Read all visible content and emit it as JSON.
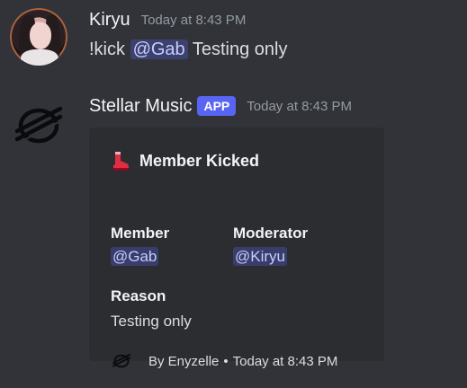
{
  "messages": [
    {
      "author": "Kiryu",
      "timestamp": "Today at 8:43 PM",
      "content": {
        "prefix": "!kick",
        "mention": "@Gab",
        "suffix": "Testing only"
      }
    },
    {
      "author": "Stellar Music",
      "badge": "APP",
      "timestamp": "Today at 8:43 PM",
      "embed": {
        "title_icon": "boot-icon",
        "title": "Member Kicked",
        "fields": [
          {
            "name": "Member",
            "value": "@Gab"
          },
          {
            "name": "Moderator",
            "value": "@Kiryu"
          },
          {
            "name": "Reason",
            "value": "Testing only"
          }
        ],
        "footer": {
          "icon": "stellar-logo-icon",
          "author": "By Enyzelle",
          "separator": "•",
          "timestamp": "Today at 8:43 PM"
        }
      }
    }
  ],
  "colors": {
    "background": "#313338",
    "embed_background": "#2b2d31",
    "mention_text": "#c9cdfb",
    "badge": "#5865f2",
    "timestamp": "#949ba4"
  }
}
